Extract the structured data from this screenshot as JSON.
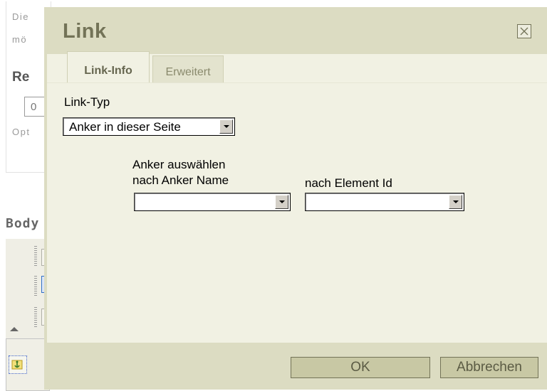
{
  "background": {
    "text_line1": "Die",
    "text_line2": "mö",
    "heading": "Re",
    "input_value": "0",
    "hint": "Opt",
    "section_label": "Body"
  },
  "dialog": {
    "title": "Link",
    "tabs": [
      {
        "label": "Link-Info",
        "active": true
      },
      {
        "label": "Erweitert",
        "active": false
      }
    ],
    "link_type": {
      "label": "Link-Typ",
      "value": "Anker in dieser Seite"
    },
    "anchor": {
      "heading": "Anker auswählen",
      "by_name_label": "nach Anker Name",
      "by_name_value": "",
      "by_id_label": "nach Element Id",
      "by_id_value": ""
    },
    "buttons": {
      "ok": "OK",
      "cancel": "Abbrechen"
    }
  },
  "icons": {
    "close": "close-icon",
    "dropdown": "chevron-down-icon",
    "anchor": "anchor-icon"
  },
  "colors": {
    "dialog_frame": "#dcdcc2",
    "dialog_body": "#f1f1e3",
    "title_text": "#737357",
    "button_bg": "#c8c8a4"
  }
}
